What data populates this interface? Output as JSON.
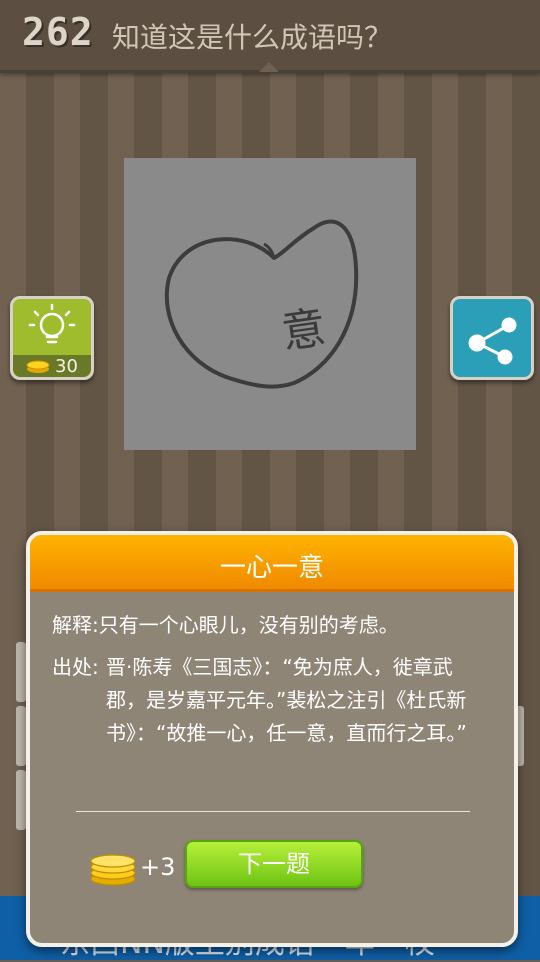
{
  "header": {
    "level": "262",
    "question": "知道这是什么成语吗？"
  },
  "puzzle": {
    "image_icon": "heart-with-character-icon",
    "drawn_character": "意"
  },
  "hint_button": {
    "icon": "lightbulb-icon",
    "cost": "30"
  },
  "share_button": {
    "icon": "share-icon"
  },
  "bottom_banner": {
    "text": "东西NN版土别成语一年一校"
  },
  "dialog": {
    "title": "一心一意",
    "explanation_label": "解释:",
    "explanation": "只有一个心眼儿，没有别的考虑。",
    "source_label": "出处:",
    "source": "晋·陈寿《三国志》：“免为庶人，徙章武郡，是岁嘉平元年。”裴松之注引《杜氏新书》：“故推一心，任一意，直而行之耳。”",
    "reward": "+3",
    "reward_icon": "coin-stack-icon",
    "next_label": "下一题"
  },
  "colors": {
    "accent_orange": "#f59a00",
    "next_green": "#8bd926",
    "hint_green": "#9fbc2f",
    "share_teal": "#2b9fb8"
  }
}
